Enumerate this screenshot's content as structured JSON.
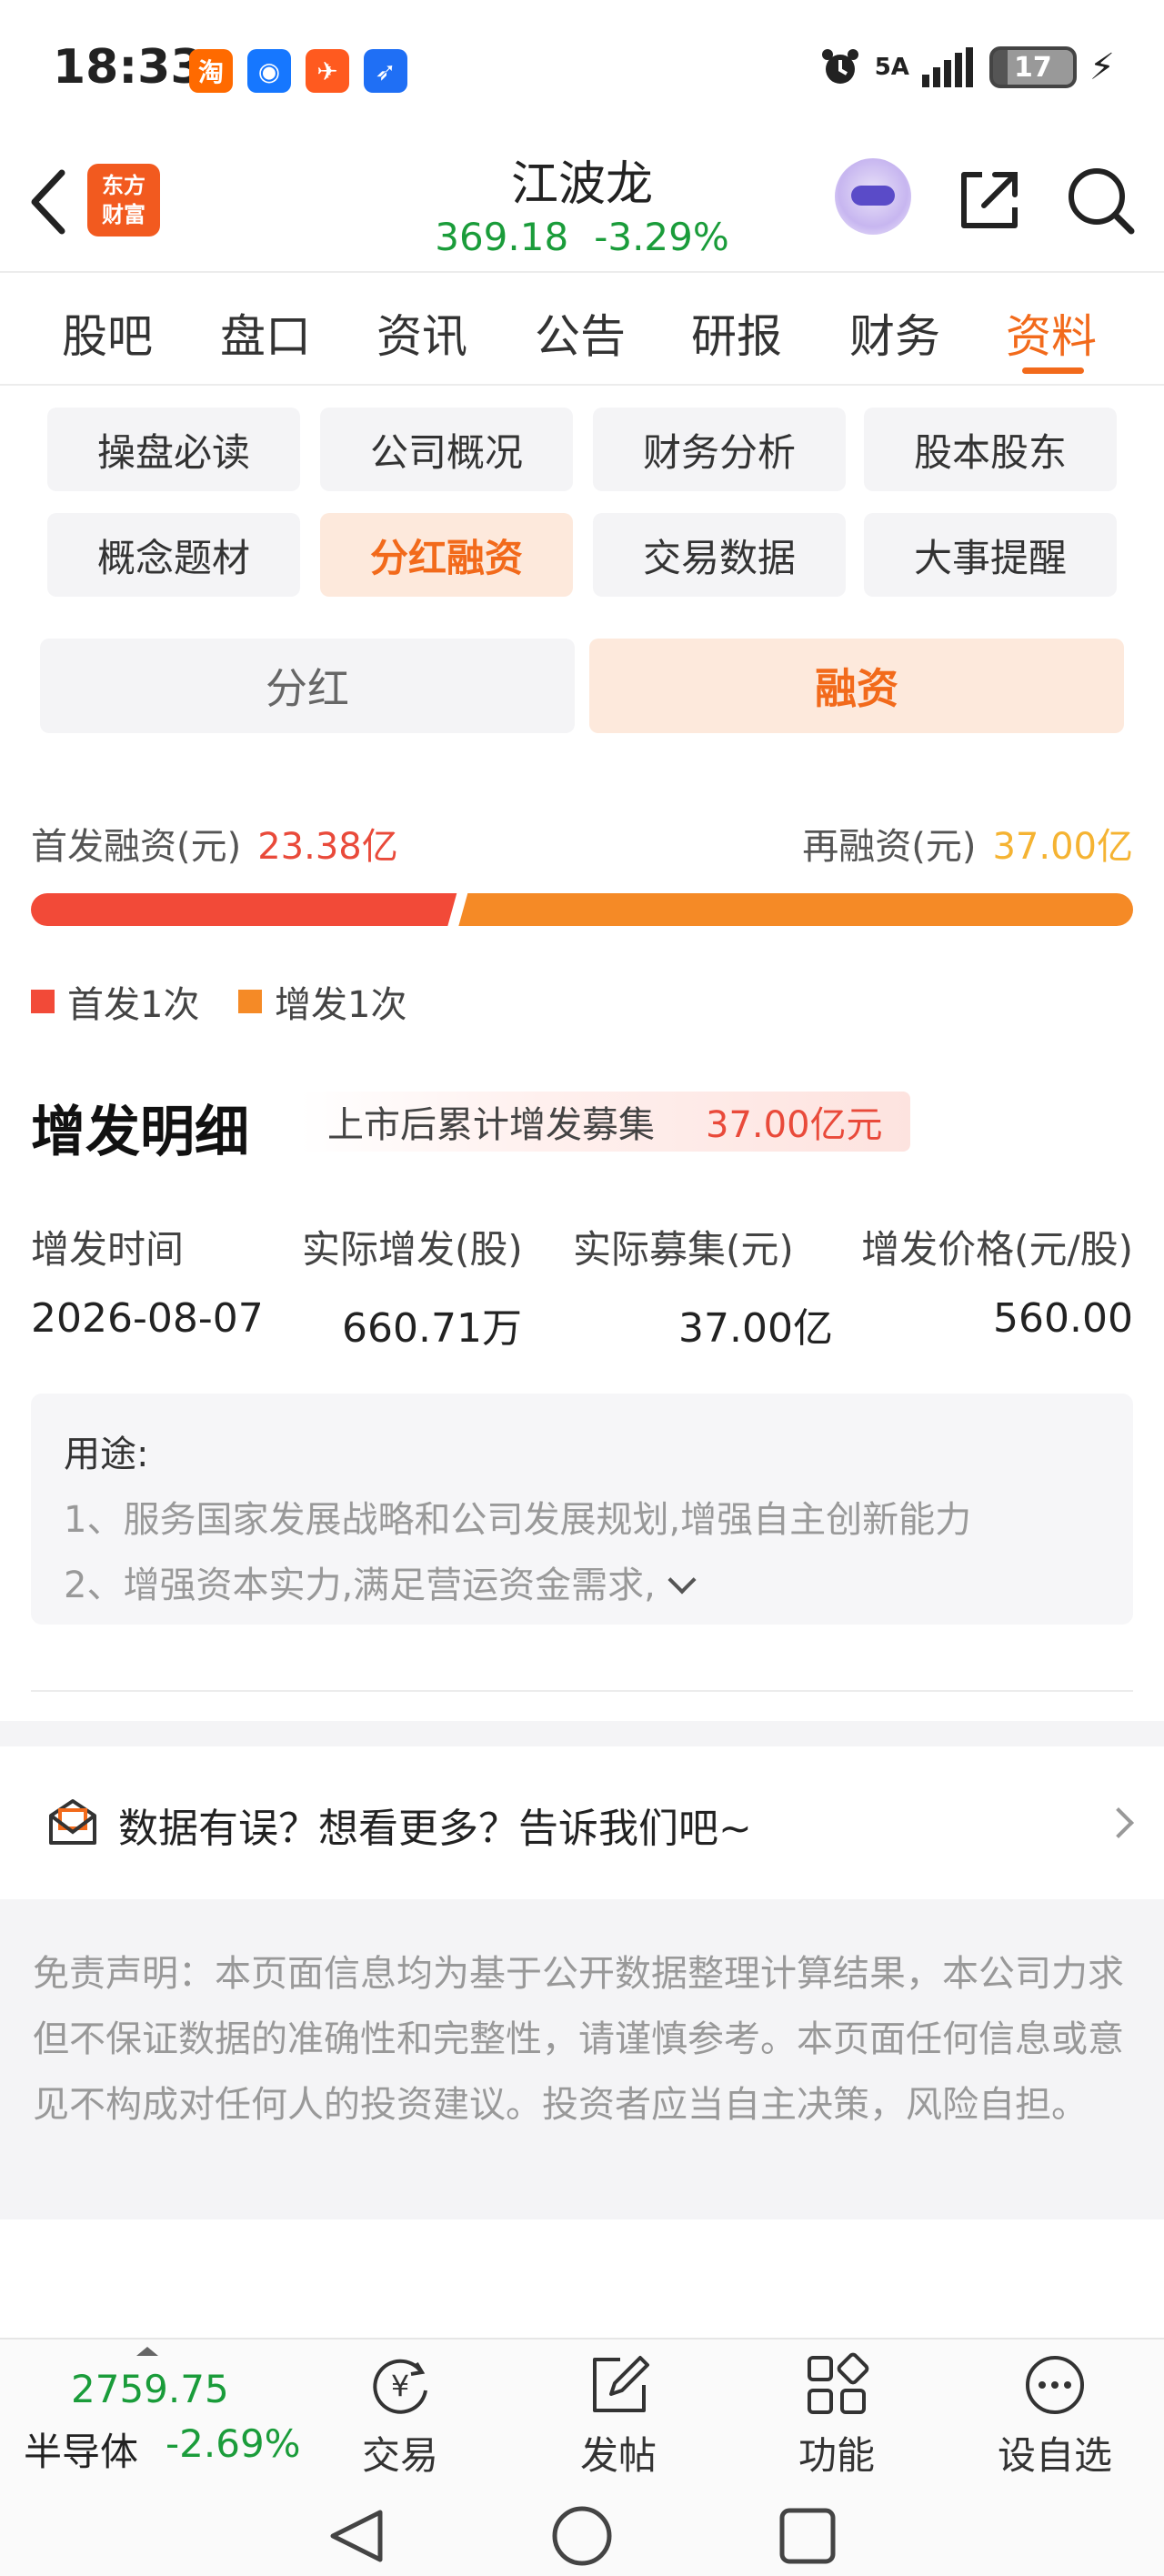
{
  "status_bar": {
    "time": "18:33",
    "signal_text": "5A",
    "battery": "17",
    "app_icons": [
      {
        "name": "taobao-icon",
        "glyph": "淘",
        "color": "#ff6a00"
      },
      {
        "name": "robot-app-icon",
        "glyph": "◉",
        "color": "#1677ff"
      },
      {
        "name": "paper-plane-app-icon",
        "glyph": "✈",
        "color": "#ff5a1f"
      },
      {
        "name": "bird-app-icon",
        "glyph": "➶",
        "color": "#1f6ff5"
      }
    ]
  },
  "header": {
    "logo_line1": "东方",
    "logo_line2": "财富",
    "stock_name": "江波龙",
    "price": "369.18",
    "change_pct": "-3.29%"
  },
  "main_tabs": [
    "股吧",
    "盘口",
    "资讯",
    "公告",
    "研报",
    "财务",
    "资料"
  ],
  "sub_tabs": [
    "操盘必读",
    "公司概况",
    "财务分析",
    "股本股东",
    "概念题材",
    "分红融资",
    "交易数据",
    "大事提醒"
  ],
  "segment": {
    "left": "分红",
    "right": "融资"
  },
  "financing": {
    "ipo_label": "首发融资(元)",
    "ipo_value": "23.38亿",
    "refi_label": "再融资(元)",
    "refi_value": "37.00亿",
    "ipo_amount": 23.38,
    "refi_amount": 37.0,
    "legend_ipo": "首发1次",
    "legend_add": "增发1次",
    "color_ipo": "#f24a38",
    "color_add": "#f58a26"
  },
  "detail": {
    "title": "增发明细",
    "badge_label": "上市后累计增发募集",
    "badge_value": "37.00亿元",
    "headers": [
      "增发时间",
      "实际增发(股)",
      "实际募集(元)",
      "增发价格(元/股)"
    ],
    "row": [
      "2026-08-07",
      "660.71万",
      "37.00亿",
      "560.00"
    ],
    "usage_label": "用途:",
    "usage_line1": "1、服务国家发展战略和公司发展规划,增强自主创新能力",
    "usage_line2": "2、增强资本实力,满足营运资金需求,"
  },
  "feedback": {
    "text": "数据有误？想看更多？告诉我们吧~"
  },
  "disclaimer": "免责声明：本页面信息均为基于公开数据整理计算结果，本公司力求但不保证数据的准确性和完整性，请谨慎参考。本页面任何信息或意见不构成对任何人的投资建议。投资者应当自主决策，风险自担。",
  "bottom_bar": {
    "index_value": "2759.75",
    "index_name": "半导体",
    "index_change": "-2.69%",
    "nav": [
      "交易",
      "发帖",
      "功能",
      "设自选"
    ]
  }
}
